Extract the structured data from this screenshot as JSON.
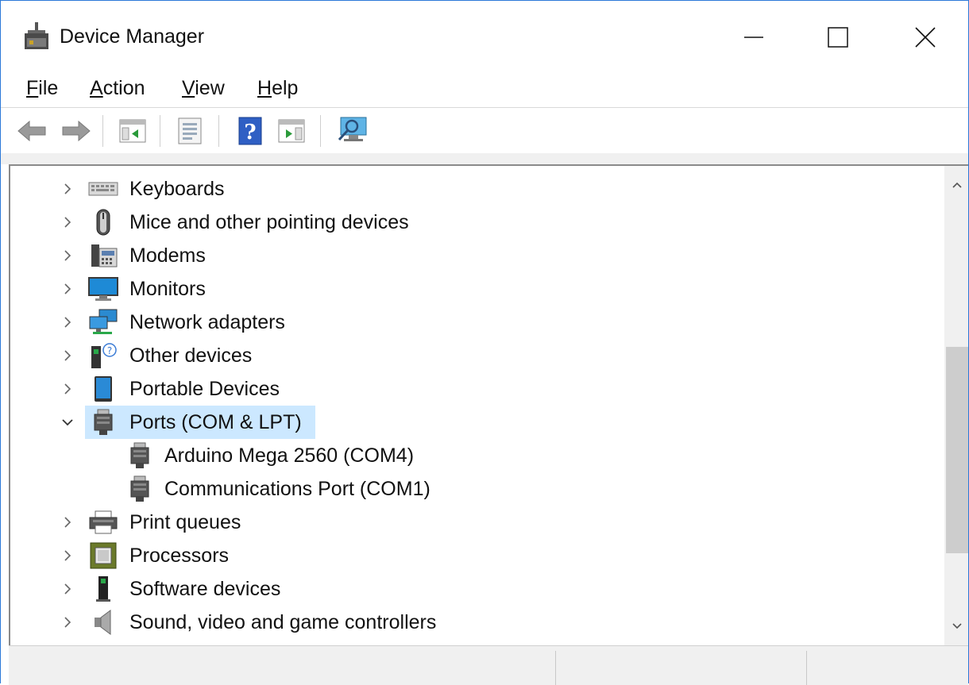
{
  "window": {
    "title": "Device Manager"
  },
  "menu": {
    "file": {
      "mnemonic": "F",
      "rest": "ile"
    },
    "action": {
      "mnemonic": "A",
      "rest": "ction"
    },
    "view": {
      "mnemonic": "V",
      "rest": "iew"
    },
    "help": {
      "mnemonic": "H",
      "rest": "elp"
    }
  },
  "toolbar": {
    "buttons": [
      "back-icon",
      "forward-icon",
      "show-hide-console-tree-icon",
      "properties-icon",
      "help-icon",
      "show-hide-action-pane-icon",
      "scan-hardware-icon"
    ]
  },
  "tree": {
    "items": [
      {
        "label": "Keyboards",
        "icon": "keyboard-icon",
        "expanded": false
      },
      {
        "label": "Mice and other pointing devices",
        "icon": "mouse-icon",
        "expanded": false
      },
      {
        "label": "Modems",
        "icon": "modem-icon",
        "expanded": false
      },
      {
        "label": "Monitors",
        "icon": "monitor-icon",
        "expanded": false
      },
      {
        "label": "Network adapters",
        "icon": "network-adapter-icon",
        "expanded": false
      },
      {
        "label": "Other devices",
        "icon": "other-devices-icon",
        "expanded": false
      },
      {
        "label": "Portable Devices",
        "icon": "portable-device-icon",
        "expanded": false
      },
      {
        "label": "Ports (COM & LPT)",
        "icon": "port-icon",
        "expanded": true,
        "selected": true,
        "children": [
          {
            "label": "Arduino Mega 2560 (COM4)",
            "icon": "port-icon"
          },
          {
            "label": "Communications Port (COM1)",
            "icon": "port-icon"
          }
        ]
      },
      {
        "label": "Print queues",
        "icon": "printer-icon",
        "expanded": false
      },
      {
        "label": "Processors",
        "icon": "processor-icon",
        "expanded": false
      },
      {
        "label": "Software devices",
        "icon": "software-device-icon",
        "expanded": false
      },
      {
        "label": "Sound, video and game controllers",
        "icon": "speaker-icon",
        "expanded": false
      }
    ]
  },
  "colors": {
    "accent": "#2b79d8",
    "selection": "#cce8ff"
  }
}
